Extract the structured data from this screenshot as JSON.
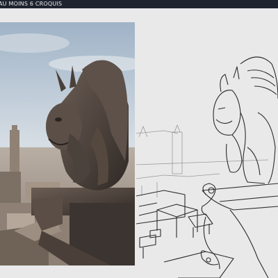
{
  "window": {
    "title": "AU MOINS 6 CROQUIS"
  },
  "colors": {
    "titlebar_bg": "#1f2330",
    "titlebar_text": "#e8e8e8",
    "canvas_bg": "#e9e9e9",
    "sketch_line": "#2a2a2a"
  },
  "panels": {
    "reference": {
      "kind": "photo",
      "subject": "gargoyle"
    },
    "sketch": {
      "kind": "line-drawing",
      "subject": "gargoyle"
    }
  }
}
